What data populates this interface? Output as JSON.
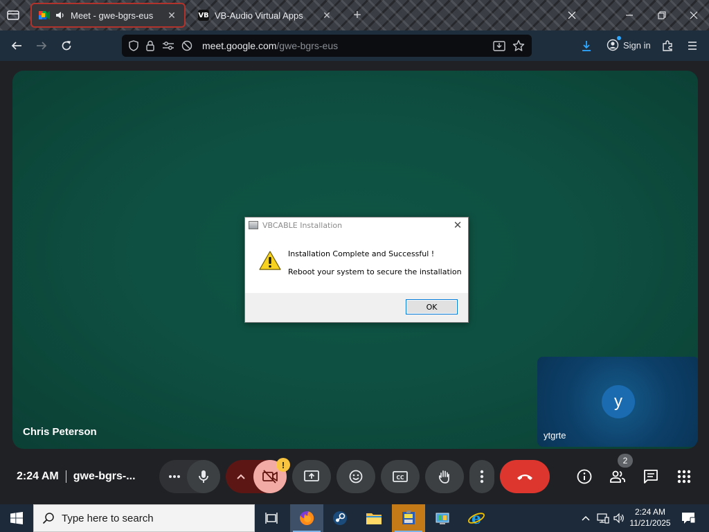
{
  "browser": {
    "tabs": [
      {
        "title": "Meet - gwe-bgrs-eus",
        "active": true
      },
      {
        "title": "VB-Audio Virtual Apps",
        "active": false
      }
    ],
    "tab_close_glyph": "✕",
    "new_tab_glyph": "+",
    "url_domain": "meet.google.com",
    "url_path": "/gwe-bgrs-eus",
    "sign_in_label": "Sign in",
    "accent_color": "#b2332b"
  },
  "meet": {
    "main_participant": "Chris Peterson",
    "self_initial": "y",
    "self_name": "ytgrte",
    "time": "2:24 AM",
    "meeting_code": "gwe-bgrs-...",
    "camera_warning_glyph": "!",
    "people_count": "2",
    "end_call_color": "#dc362e"
  },
  "dialog": {
    "title": "VBCABLE Installation",
    "message_line1": "Installation Complete and Successful !",
    "message_line2": "Reboot your system to secure the installation",
    "ok_label": "OK",
    "close_glyph": "✕",
    "icon": "warning-icon"
  },
  "taskbar": {
    "search_placeholder": "Type here to search",
    "time": "2:24 AM",
    "date": "11/21/2025",
    "apps": [
      "task-view-icon",
      "firefox-icon",
      "steam-icon",
      "file-explorer-icon",
      "vbcable-installer-icon",
      "control-panel-icon",
      "internet-explorer-icon"
    ]
  }
}
